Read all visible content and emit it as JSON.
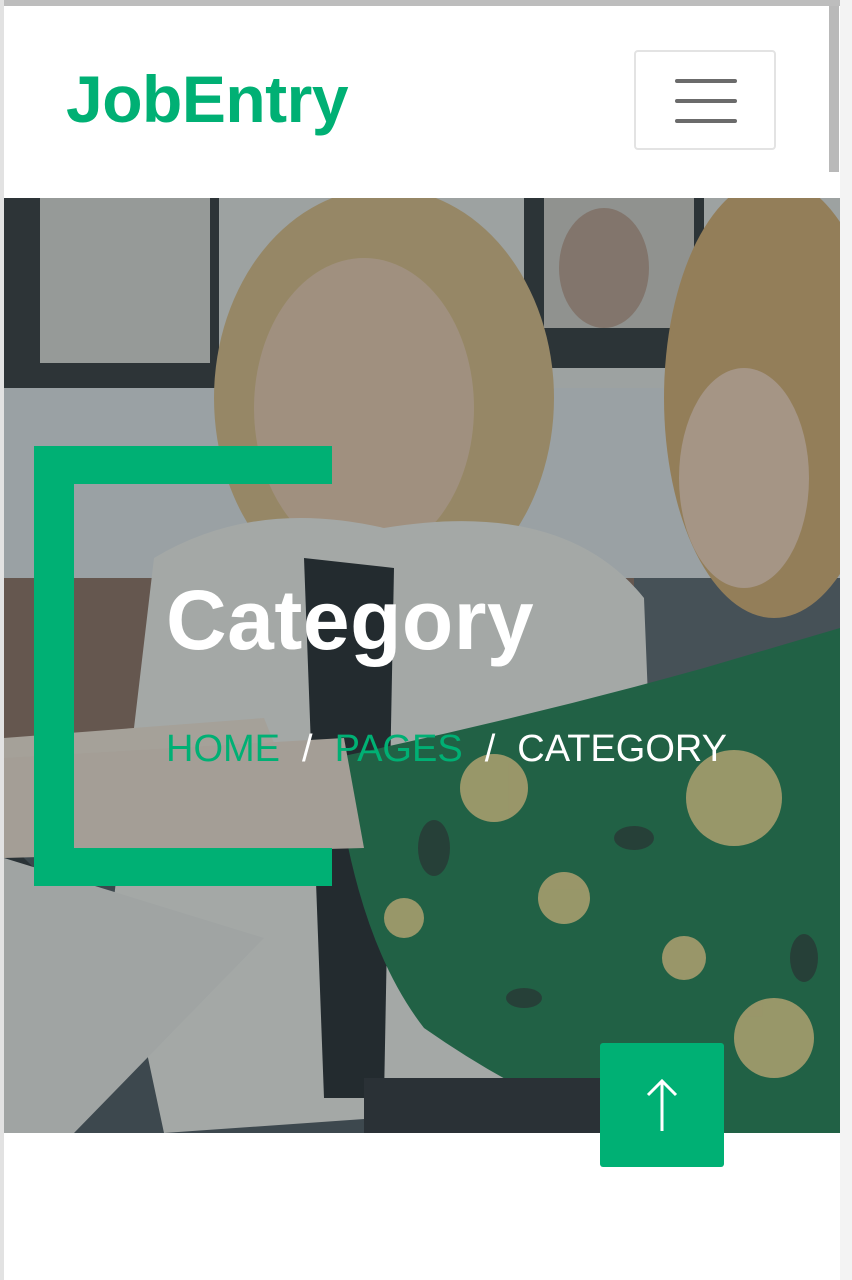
{
  "navbar": {
    "brand": "JobEntry",
    "toggler_icon": "hamburger-menu-icon"
  },
  "hero": {
    "title": "Category",
    "breadcrumb": {
      "home": "HOME",
      "pages": "PAGES",
      "current": "CATEGORY",
      "separator": "/"
    }
  },
  "back_to_top": {
    "icon": "arrow-up-icon"
  },
  "colors": {
    "primary": "#00b074",
    "white": "#ffffff",
    "overlay": "#2b3940"
  }
}
